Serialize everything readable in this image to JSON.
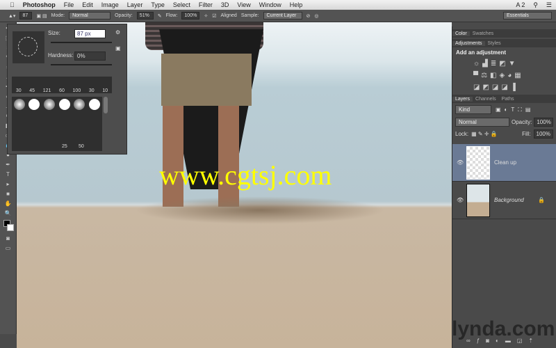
{
  "menubar": {
    "app": "Photoshop",
    "items": [
      "File",
      "Edit",
      "Image",
      "Layer",
      "Type",
      "Select",
      "Filter",
      "3D",
      "View",
      "Window",
      "Help"
    ],
    "status": "A 2"
  },
  "options": {
    "brush_size": "87",
    "mode_label": "Mode:",
    "mode": "Normal",
    "opacity_label": "Opacity:",
    "opacity": "51%",
    "flow_label": "Flow:",
    "flow": "100%",
    "aligned_label": "Aligned",
    "sample_label": "Sample:",
    "sample": "Current Layer",
    "workspace": "Essentials"
  },
  "brush_popup": {
    "size_label": "Size:",
    "size": "87 px",
    "hardness_label": "Hardness:",
    "hardness": "0%",
    "presets": [
      "30",
      "45",
      "121",
      "60",
      "100",
      "30",
      "10"
    ],
    "bottom_labels": [
      "25",
      "50"
    ]
  },
  "panels": {
    "color_tabs": [
      "Color",
      "Swatches"
    ],
    "adj_tabs": [
      "Adjustments",
      "Styles"
    ],
    "adj_title": "Add an adjustment",
    "layer_tabs": [
      "Layers",
      "Channels",
      "Paths"
    ],
    "filter": "Kind",
    "blend": "Normal",
    "opacity_label": "Opacity:",
    "opacity": "100%",
    "lock_label": "Lock:",
    "fill_label": "Fill:",
    "fill": "100%"
  },
  "layers": [
    {
      "name": "Clean up",
      "active": true
    },
    {
      "name": "Background",
      "active": false,
      "locked": true
    }
  ],
  "watermark": "www.cgtsj.com",
  "lynda": "lynda.com"
}
